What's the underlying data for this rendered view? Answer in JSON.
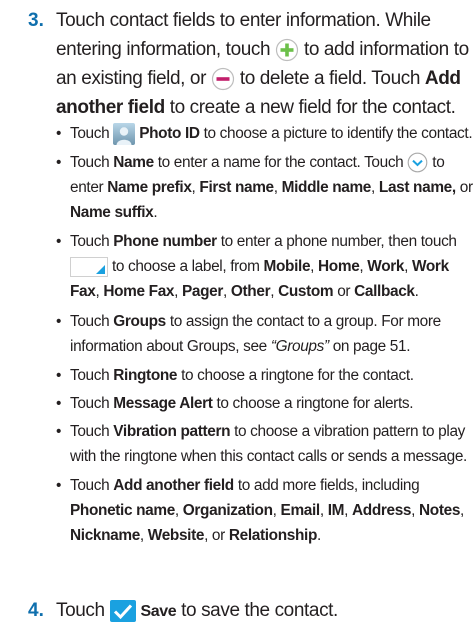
{
  "steps": [
    {
      "number": "3.",
      "lines": [
        {
          "t1": "Touch contact fields to enter information. While"
        },
        {
          "t1": "entering information, touch",
          "t2": "to add information to",
          "icon": "plus-circle-icon"
        },
        {
          "t1": "an existing field, or",
          "t2": "to delete a field. Touch",
          "b1": "Add",
          "icon": "minus-circle-icon"
        },
        {
          "b1": "another field",
          "t1": "to create a new field for the contact."
        }
      ]
    },
    {
      "number": "4.",
      "t1": "Touch",
      "icon": "checkmark-icon",
      "b1": "Save",
      "t2": "to save the contact."
    }
  ],
  "bullets": [
    {
      "symbol": "•",
      "lines": [
        {
          "t1": "Touch",
          "icon": "contact-photo-icon",
          "b1": "Photo ID",
          "t2": "to choose a picture to identify the contact."
        }
      ]
    },
    {
      "symbol": "•",
      "lines": [
        {
          "t1": "Touch",
          "b1": "Name",
          "t2": "to enter a name for the contact. Touch",
          "icon": "chevron-down-circle-icon",
          "t3": "to"
        },
        {
          "t1": "enter",
          "b1": "Name prefix",
          "t2": ",",
          "b2": "First name",
          "t3": ",",
          "b3": "Middle name",
          "t4": ",",
          "b4": "Last name,",
          "t5": "or"
        },
        {
          "b1": "Name suffix",
          "t1": "."
        }
      ]
    },
    {
      "symbol": "•",
      "lines": [
        {
          "t1": "Touch",
          "b1": "Phone number",
          "t2": "to enter a phone number, then touch"
        },
        {
          "icon": "label-selector-icon",
          "t1": "to choose a label, from",
          "b1": "Mobile",
          "t2": ",",
          "b2": "Home",
          "t3": ",",
          "b3": "Work",
          "t4": ",",
          "b4": "Work"
        },
        {
          "b1": "Fax",
          "t1": ",",
          "b2": "Home Fax",
          "t2": ",",
          "b3": "Pager",
          "t3": ",",
          "b4": "Other",
          "t4": ",",
          "b5": "Custom",
          "t5": "or",
          "b6": "Callback",
          "t6": "."
        }
      ]
    },
    {
      "symbol": "•",
      "lines": [
        {
          "t1": "Touch",
          "b1": "Groups",
          "t2": "to assign the contact to a group. For more"
        },
        {
          "t1": "information about Groups, see",
          "i1": "“Groups”",
          "t2": "on page 51."
        }
      ]
    },
    {
      "symbol": "•",
      "lines": [
        {
          "t1": "Touch",
          "b1": "Ringtone",
          "t2": "to choose a ringtone for the contact."
        }
      ]
    },
    {
      "symbol": "•",
      "lines": [
        {
          "t1": "Touch",
          "b1": "Message Alert",
          "t2": "to choose a ringtone for alerts."
        }
      ]
    },
    {
      "symbol": "•",
      "lines": [
        {
          "t1": "Touch",
          "b1": "Vibration pattern",
          "t2": "to choose a vibration pattern to play"
        },
        {
          "t1": "with the ringtone when this contact calls or sends a message."
        }
      ]
    },
    {
      "symbol": "•",
      "lines": [
        {
          "t1": "Touch",
          "b1": "Add another field",
          "t2": "to add more fields, including"
        },
        {
          "b1": "Phonetic name",
          "t1": ",",
          "b2": "Organization",
          "t2": ",",
          "b3": "Email",
          "t3": ",",
          "b4": "IM",
          "t4": ",",
          "b5": "Address",
          "t5": ",",
          "b6": "Notes",
          "t6": ","
        },
        {
          "b1": "Nickname",
          "t1": ",",
          "b2": "Website",
          "t2": ", or",
          "b3": "Relationship",
          "t3": "."
        }
      ]
    }
  ],
  "colors": {
    "step_number": "#0f6fad",
    "text": "#231f20",
    "plus_icon": "#6cc04a",
    "minus_icon": "#c21f6b",
    "icon_blue": "#1aa1e0"
  }
}
